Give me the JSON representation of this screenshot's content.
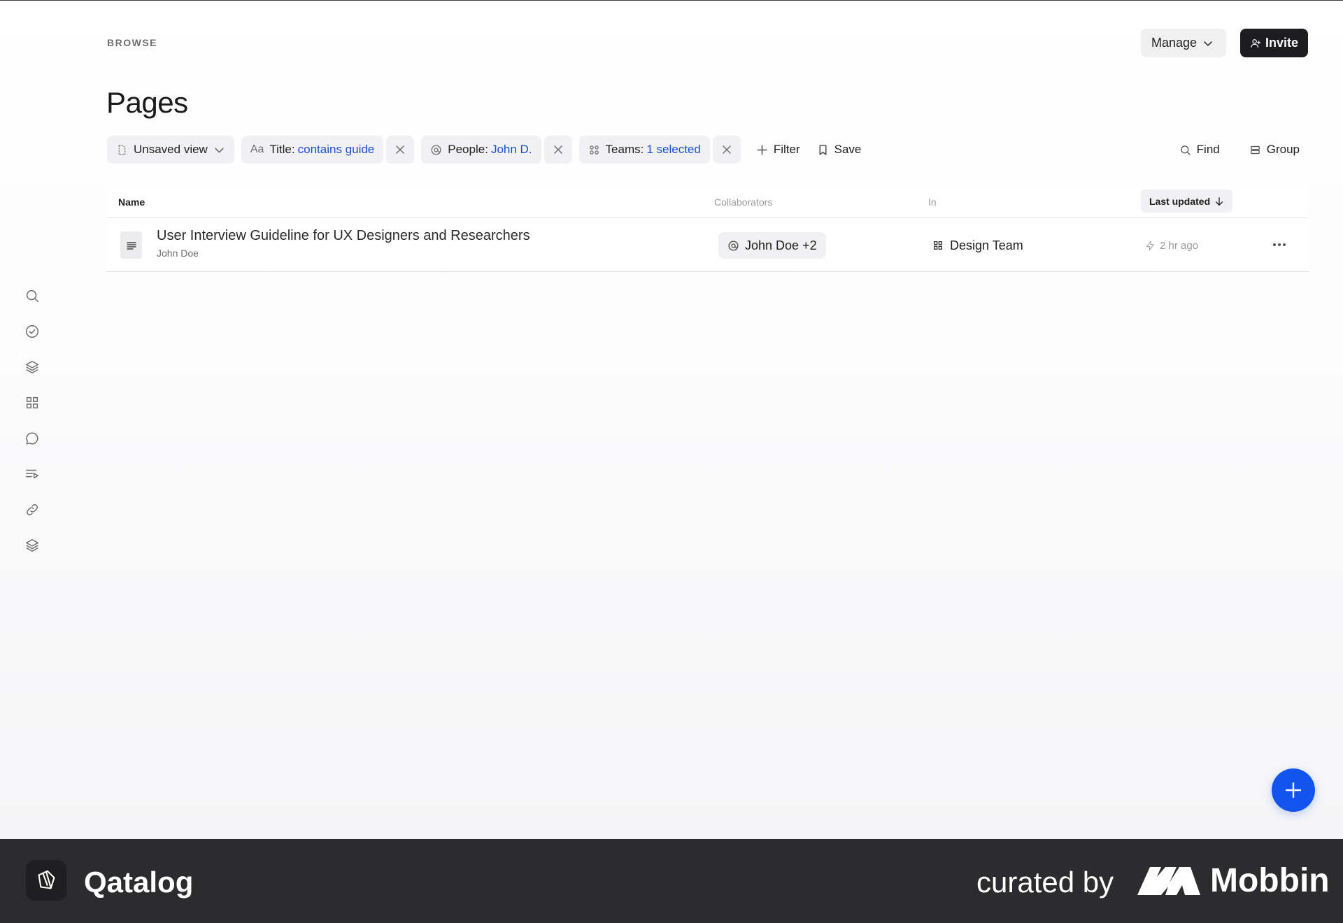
{
  "header": {
    "eyebrow": "BROWSE",
    "title": "Pages",
    "manage_label": "Manage",
    "invite_label": "Invite"
  },
  "sidebar": {
    "items": [
      {
        "icon": "search-icon"
      },
      {
        "icon": "check-circle-icon"
      },
      {
        "icon": "layers-icon"
      },
      {
        "icon": "grid-icon"
      },
      {
        "icon": "chat-bubble-icon"
      },
      {
        "icon": "playlist-icon"
      },
      {
        "icon": "link-icon"
      },
      {
        "icon": "stack-icon"
      }
    ]
  },
  "filters": {
    "view_label": "Unsaved view",
    "title_filter": {
      "prefix": "Aa",
      "label": "Title:",
      "value": "contains guide"
    },
    "people_filter": {
      "label": "People:",
      "value": "John D."
    },
    "teams_filter": {
      "label": "Teams:",
      "value": "1 selected"
    },
    "add_filter_label": "Filter",
    "save_label": "Save",
    "find_label": "Find",
    "group_label": "Group"
  },
  "table": {
    "columns": {
      "name": "Name",
      "collaborators": "Collaborators",
      "in": "In",
      "last_updated": "Last updated"
    },
    "rows": [
      {
        "title": "User Interview Guideline for UX Designers and Researchers",
        "author": "John Doe",
        "collaborators": "John Doe +2",
        "in": "Design Team",
        "updated": "2 hr ago"
      }
    ]
  },
  "colors": {
    "accent": "#1155ee",
    "filter_value": "#1b4fd0",
    "invite_bg": "#1d1d1f",
    "footer_bg": "#2c2c2e"
  },
  "footer": {
    "app_name": "Qatalog",
    "curated_by": "curated by",
    "mobbin": "Mobbin"
  }
}
